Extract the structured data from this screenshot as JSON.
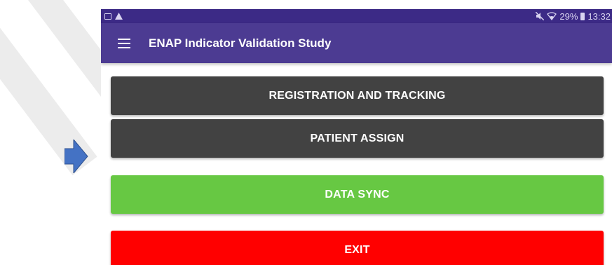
{
  "status_bar": {
    "battery": "29%",
    "time": "13:32",
    "left_icons": [
      "image-icon",
      "warning-icon"
    ],
    "right_icons": [
      "mute-icon",
      "wifi-icon",
      "battery-icon"
    ]
  },
  "app_bar": {
    "title": "ENAP Indicator Validation Study",
    "menu_icon": "menu-icon"
  },
  "buttons": {
    "registration": "REGISTRATION AND TRACKING",
    "patient_assign": "PATIENT ASSIGN",
    "data_sync": "DATA SYNC",
    "exit": "EXIT"
  },
  "colors": {
    "status_bar": "#3c2a86",
    "app_bar": "#4c3b92",
    "dark_button": "#424242",
    "sync_button": "#67c843",
    "exit_button": "#ff0000",
    "arrow": "#4472c4"
  }
}
